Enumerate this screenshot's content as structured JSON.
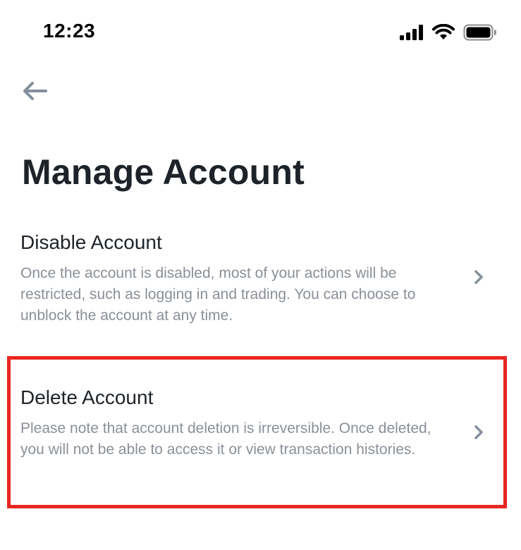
{
  "status_bar": {
    "time": "12:23",
    "icons": [
      "cellular-signal-icon",
      "wifi-icon",
      "battery-icon"
    ]
  },
  "nav": {
    "back_icon": "arrow-left-icon"
  },
  "page": {
    "title": "Manage Account"
  },
  "options": [
    {
      "title": "Disable Account",
      "description": "Once the account is disabled, most of your actions will be restricted, such as logging in and trading. You can choose to unblock the account at any time.",
      "icon": "chevron-right-icon"
    },
    {
      "title": "Delete Account",
      "description": "Please note that account deletion is irreversible. Once deleted, you will not be able to access it or view transaction histories.",
      "icon": "chevron-right-icon"
    }
  ],
  "colors": {
    "title_text": "#1e2329",
    "secondary_text": "#8a8f98",
    "icon_gray": "#848e9c",
    "highlight_border": "#e8271f"
  }
}
